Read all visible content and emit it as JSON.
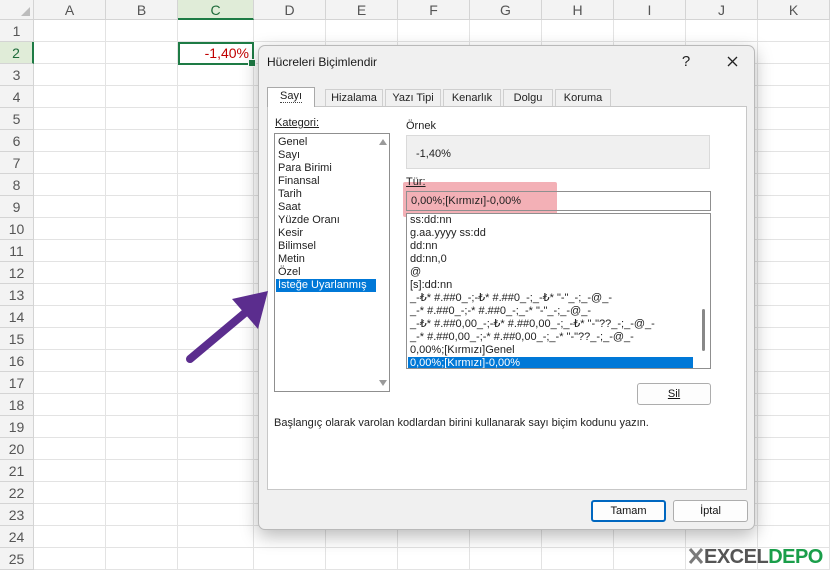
{
  "sheet": {
    "columns": [
      "A",
      "B",
      "C",
      "D",
      "E",
      "F",
      "G",
      "H",
      "I",
      "J",
      "K"
    ],
    "rows": [
      "1",
      "2",
      "3",
      "4",
      "5",
      "6",
      "7",
      "8",
      "9",
      "10",
      "11",
      "12",
      "13",
      "14",
      "15",
      "16",
      "17",
      "18",
      "19",
      "20",
      "21",
      "22",
      "23",
      "24",
      "25"
    ],
    "selected_column": "C",
    "selected_row": "2",
    "active_cell_value": "-1,40%",
    "active_cell_color": "#c00000",
    "accent": "#1e7b45"
  },
  "dialog": {
    "title": "Hücreleri Biçimlendir",
    "help_label": "?",
    "close_label": "✕",
    "tabs": [
      {
        "label": "Sayı",
        "active": true
      },
      {
        "label": "Hizalama"
      },
      {
        "label": "Yazı Tipi"
      },
      {
        "label": "Kenarlık"
      },
      {
        "label": "Dolgu"
      },
      {
        "label": "Koruma"
      }
    ],
    "category_label": "Kategori:",
    "categories": [
      "Genel",
      "Sayı",
      "Para Birimi",
      "Finansal",
      "Tarih",
      "Saat",
      "Yüzde Oranı",
      "Kesir",
      "Bilimsel",
      "Metin",
      "Özel",
      "İsteğe Uyarlanmış"
    ],
    "selected_category": "İsteğe Uyarlanmış",
    "sample_label": "Örnek",
    "sample_value": "-1,40%",
    "type_label": "Tür:",
    "type_value": "0,00%;[Kırmızı]-0,00%",
    "formats": [
      "ss:dd:nn",
      "g.aa.yyyy ss:dd",
      "dd:nn",
      "dd:nn,0",
      "@",
      "[s]:dd:nn",
      "_-₺* #.##0_-;-₺* #.##0_-;_-₺* \"-\"_-;_-@_-",
      "_-* #.##0_-;-* #.##0_-;_-* \"-\"_-;_-@_-",
      "_-₺* #.##0,00_-;-₺* #.##0,00_-;_-₺* \"-\"??_-;_-@_-",
      "_-* #.##0,00_-;-* #.##0,00_-;_-* \"-\"??_-;_-@_-",
      "0,00%;[Kırmızı]Genel",
      "0,00%;[Kırmızı]-0,00%"
    ],
    "selected_format": "0,00%;[Kırmızı]-0,00%",
    "delete_label": "Sil",
    "help_text": "Başlangıç olarak varolan kodlardan birini kullanarak sayı biçim kodunu yazın.",
    "ok_label": "Tamam",
    "cancel_label": "İptal",
    "highlight_color": "#f2a7ae",
    "selection_color": "#0078d7"
  },
  "annotation": {
    "arrow_icon": "purple-arrow-icon",
    "arrow_color": "#5b2d8e"
  },
  "logo": {
    "text_part1": "EXCEL",
    "text_part2": "DEPO"
  }
}
